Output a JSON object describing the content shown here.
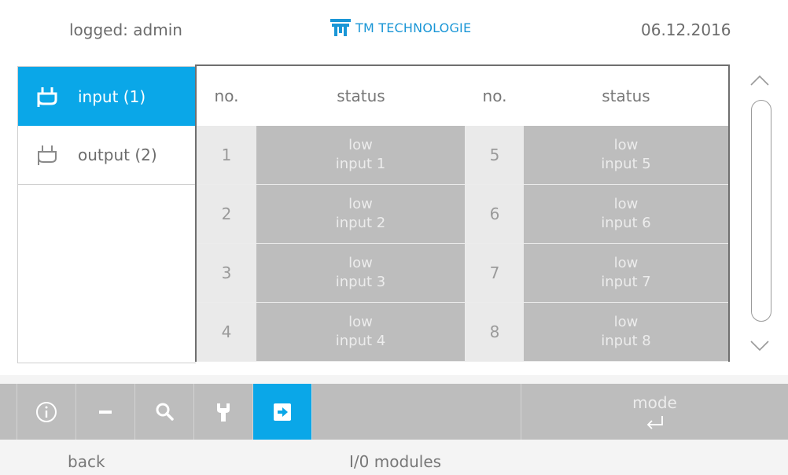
{
  "header": {
    "user_text": "logged: admin",
    "brand_text": "TM TECHNOLOGIE",
    "date_text": "06.12.2016",
    "brand_color": "#1a96d6"
  },
  "sidebar": {
    "items": [
      {
        "label": "input (1)",
        "icon": "plug-icon",
        "active": true
      },
      {
        "label": "output (2)",
        "icon": "plug-icon",
        "active": false
      }
    ],
    "active_color": "#0aa7e8"
  },
  "table": {
    "headers": [
      "no.",
      "status",
      "no.",
      "status"
    ],
    "rows": [
      {
        "no_left": "1",
        "status_left_line1": "low",
        "status_left_line2": "input 1",
        "no_right": "5",
        "status_right_line1": "low",
        "status_right_line2": "input 5"
      },
      {
        "no_left": "2",
        "status_left_line1": "low",
        "status_left_line2": "input 2",
        "no_right": "6",
        "status_right_line1": "low",
        "status_right_line2": "input 6"
      },
      {
        "no_left": "3",
        "status_left_line1": "low",
        "status_left_line2": "input 3",
        "no_right": "7",
        "status_right_line1": "low",
        "status_right_line2": "input 7"
      },
      {
        "no_left": "4",
        "status_left_line1": "low",
        "status_left_line2": "input 4",
        "no_right": "8",
        "status_right_line1": "low",
        "status_right_line2": "input 8"
      }
    ]
  },
  "toolbar": {
    "buttons": [
      {
        "icon": "info-icon"
      },
      {
        "icon": "minus-icon"
      },
      {
        "icon": "search-icon"
      },
      {
        "icon": "wrench-icon"
      },
      {
        "icon": "arrow-right-icon",
        "active": true
      }
    ],
    "mode_label": "mode",
    "mode_icon": "enter-arrow-icon"
  },
  "footer": {
    "back_label": "back",
    "page_title": "I/0 modules"
  }
}
